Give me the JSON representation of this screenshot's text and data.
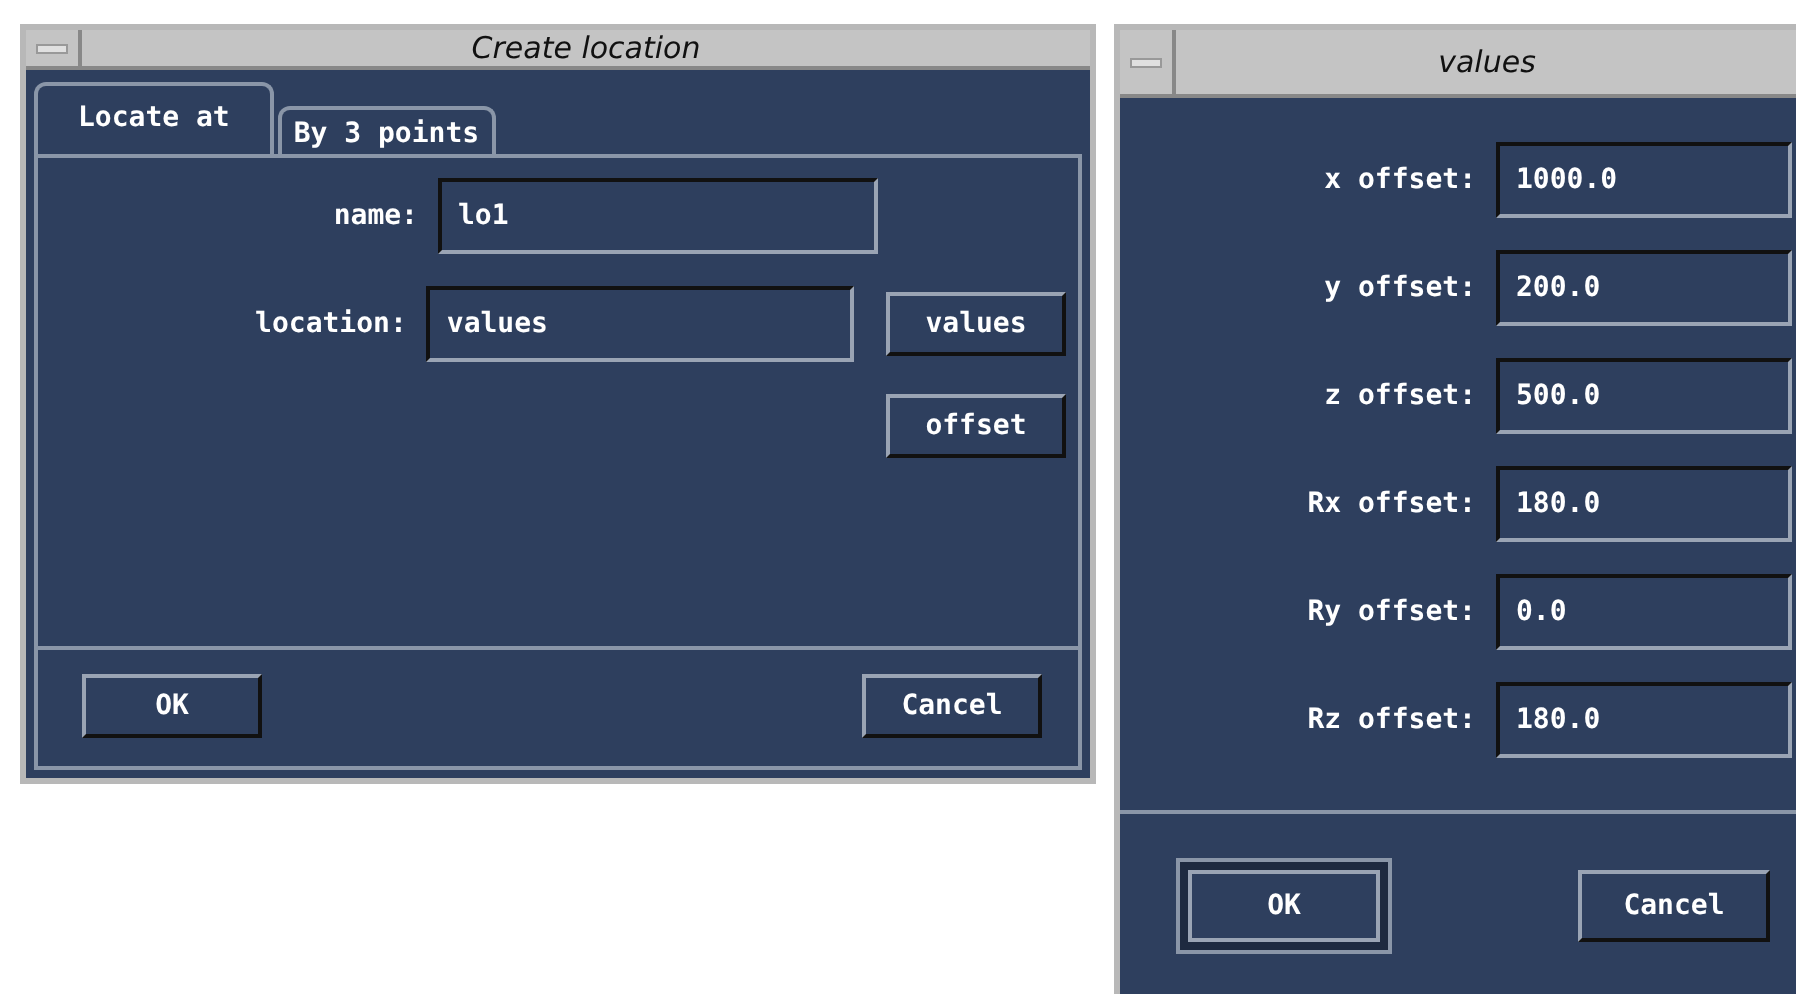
{
  "windows": [
    {
      "title": "Create location",
      "tabs": [
        {
          "label": "Locate at",
          "selected": true
        },
        {
          "label": "By 3 points",
          "selected": false
        }
      ],
      "fields": [
        {
          "label": "name:",
          "value": "lo1"
        },
        {
          "label": "location:",
          "value": "values",
          "button": "values"
        }
      ],
      "extra_buttons": [
        "offset"
      ],
      "buttons": [
        {
          "label": "OK",
          "default": false
        },
        {
          "label": "Cancel",
          "default": false
        }
      ]
    },
    {
      "title": "values",
      "fields": [
        {
          "label": "x offset:",
          "value": "1000.0"
        },
        {
          "label": "y offset:",
          "value": "200.0"
        },
        {
          "label": "z offset:",
          "value": "500.0"
        },
        {
          "label": "Rx offset:",
          "value": "180.0"
        },
        {
          "label": "Ry offset:",
          "value": "0.0"
        },
        {
          "label": "Rz offset:",
          "value": "180.0"
        }
      ],
      "buttons": [
        {
          "label": "OK",
          "default": true
        },
        {
          "label": "Cancel",
          "default": false
        }
      ]
    }
  ]
}
